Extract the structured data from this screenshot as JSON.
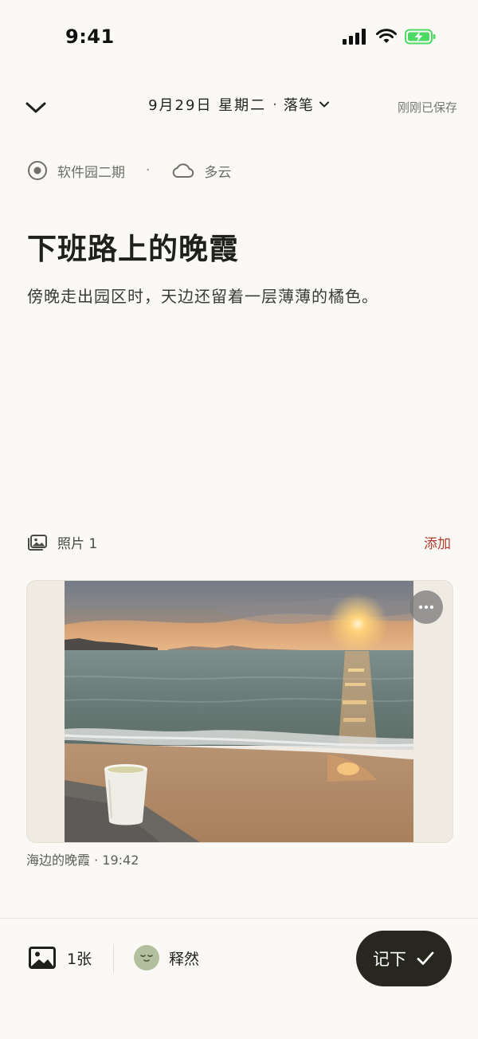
{
  "status_bar": {
    "time": "9:41"
  },
  "header": {
    "date": "9月29日 星期二",
    "separator": "·",
    "mode": "落笔",
    "save_status": "刚刚已保存"
  },
  "meta": {
    "location": "软件园二期",
    "separator": "·",
    "weather": "多云"
  },
  "entry": {
    "title": "下班路上的晚霞",
    "body": "傍晚走出园区时，天边还留着一层薄薄的橘色。"
  },
  "photos": {
    "label": "照片 1",
    "add_label": "添加",
    "items": [
      {
        "caption": "海边的晚霞 · 19:42"
      }
    ]
  },
  "bottom_bar": {
    "photo_count": "1张",
    "mood": "释然",
    "save_label": "记下"
  },
  "colors": {
    "background": "#faf9f5",
    "accent_red": "#b03a2e",
    "button_dark": "#272720",
    "mood_green": "#b3c0a0",
    "battery_green": "#4cd964"
  },
  "icons": [
    "chevron-down-icon",
    "location-icon",
    "cloud-icon",
    "photos-icon",
    "more-icon",
    "image-icon",
    "mood-face-icon",
    "check-icon",
    "cellular-icon",
    "wifi-icon",
    "battery-charging-icon"
  ]
}
